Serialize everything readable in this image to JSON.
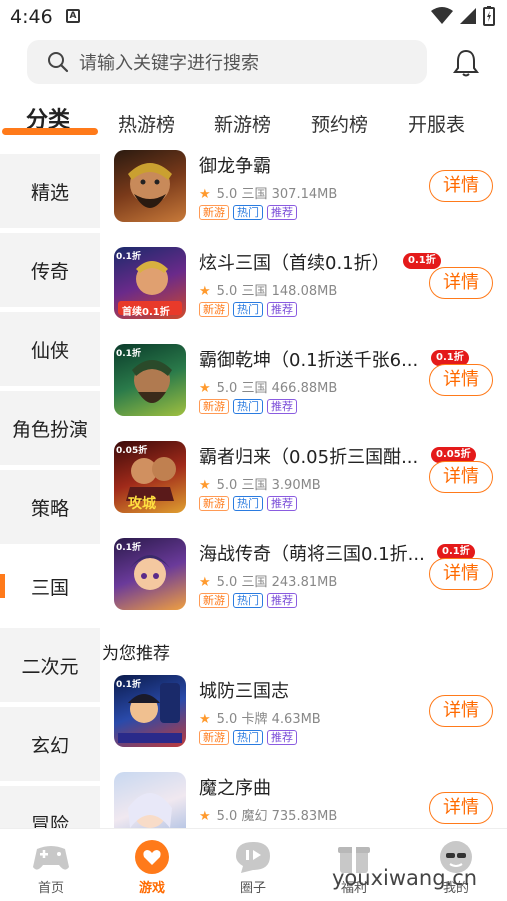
{
  "status_bar": {
    "time": "4:46",
    "a_icon": "A"
  },
  "search": {
    "placeholder": "请输入关键字进行搜索"
  },
  "tabs": [
    {
      "label": "分类"
    },
    {
      "label": "热游榜"
    },
    {
      "label": "新游榜"
    },
    {
      "label": "预约榜"
    },
    {
      "label": "开服表"
    }
  ],
  "sidebar": {
    "items": [
      {
        "label": "精选"
      },
      {
        "label": "传奇"
      },
      {
        "label": "仙侠"
      },
      {
        "label": "角色扮演"
      },
      {
        "label": "策略"
      },
      {
        "label": "三国"
      },
      {
        "label": "二次元"
      },
      {
        "label": "玄幻"
      },
      {
        "label": "冒险"
      }
    ],
    "active": "三国"
  },
  "games": [
    {
      "title": "御龙争霸",
      "rating": "5.0",
      "genre": "三国",
      "size": "307.14MB",
      "tags": [
        "新游",
        "热门",
        "推荐"
      ],
      "discount": "",
      "button": "详情"
    },
    {
      "title": "炫斗三国（首续0.1折）",
      "rating": "5.0",
      "genre": "三国",
      "size": "148.08MB",
      "tags": [
        "新游",
        "热门",
        "推荐"
      ],
      "discount": "0.1折",
      "button": "详情",
      "thumb_corner": "0.1折",
      "thumb_caption": "首续0.1折"
    },
    {
      "title": "霸御乾坤（0.1折送千张6...",
      "rating": "5.0",
      "genre": "三国",
      "size": "466.88MB",
      "tags": [
        "新游",
        "热门",
        "推荐"
      ],
      "discount": "0.1折",
      "button": "详情",
      "thumb_corner": "0.1折"
    },
    {
      "title": "霸者归来（0.05折三国酣...",
      "rating": "5.0",
      "genre": "三国",
      "size": "3.90MB",
      "tags": [
        "新游",
        "热门",
        "推荐"
      ],
      "discount": "0.05折",
      "button": "详情",
      "thumb_corner": "0.05折",
      "thumb_caption": "攻城"
    },
    {
      "title": "海战传奇（萌将三国0.1折...",
      "rating": "5.0",
      "genre": "三国",
      "size": "243.81MB",
      "tags": [
        "新游",
        "热门",
        "推荐"
      ],
      "discount": "0.1折",
      "button": "详情",
      "thumb_corner": "0.1折"
    }
  ],
  "recommend": {
    "heading": "为您推荐",
    "games": [
      {
        "title": "城防三国志",
        "rating": "5.0",
        "genre": "卡牌",
        "size": "4.63MB",
        "tags": [
          "新游",
          "热门",
          "推荐"
        ],
        "button": "详情",
        "thumb_corner": "0.1折"
      },
      {
        "title": "魔之序曲",
        "rating": "5.0",
        "genre": "魔幻",
        "size": "735.83MB",
        "tags": [],
        "button": "详情"
      }
    ]
  },
  "bottom_nav": [
    {
      "label": "首页",
      "icon": "gamepad-icon"
    },
    {
      "label": "游戏",
      "icon": "heart-chat-icon",
      "active": true
    },
    {
      "label": "圈子",
      "icon": "chat-bubble-icon"
    },
    {
      "label": "福利",
      "icon": "gift-icon"
    },
    {
      "label": "我的",
      "icon": "avatar-icon"
    }
  ],
  "watermark": "youxiwang.cn",
  "colors": {
    "accent": "#ff7a1a",
    "hot_tag": "#2a7be0",
    "rec_tag": "#7a4cd8",
    "discount": "#e41a1a"
  }
}
